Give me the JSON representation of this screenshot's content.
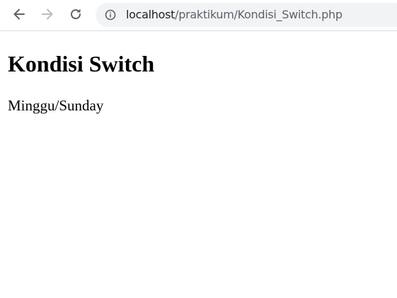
{
  "browser": {
    "toolbar": {
      "back_icon": "arrow-left-icon",
      "forward_icon": "arrow-right-icon",
      "reload_icon": "reload-icon",
      "info_icon": "info-circle-icon"
    },
    "address_bar": {
      "host": "localhost",
      "path": "/praktikum/Kondisi_Switch.php"
    }
  },
  "page": {
    "heading": "Kondisi Switch",
    "output_text": "Minggu/Sunday"
  },
  "colors": {
    "icon_active": "#5f6368",
    "icon_disabled": "#babcbe",
    "omnibox_bg": "#f1f3f4"
  }
}
